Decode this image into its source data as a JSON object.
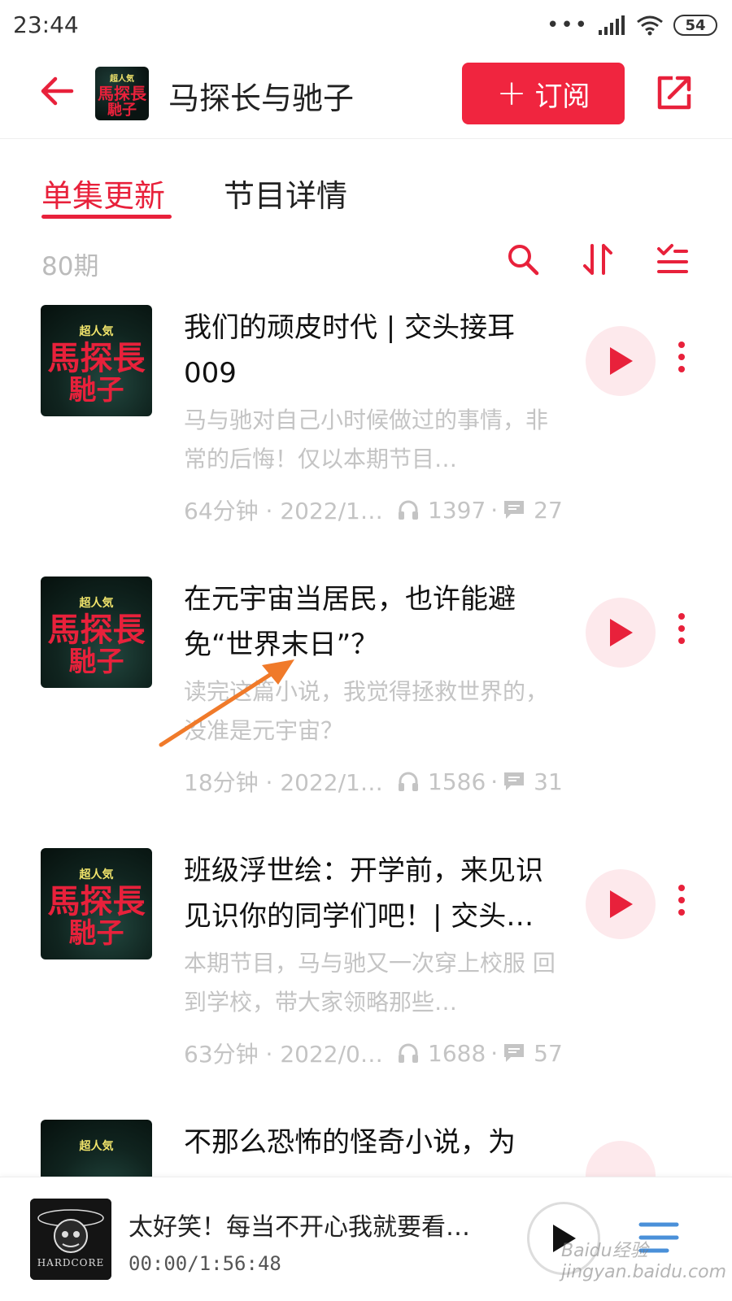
{
  "status_bar": {
    "time": "23:44",
    "battery": "54"
  },
  "header": {
    "title": "马探长与驰子",
    "subscribe_label": "订阅",
    "cover": {
      "top": "超人気",
      "main": "馬探長",
      "amp": "&",
      "sub": "馳子"
    }
  },
  "tabs": {
    "active": "单集更新",
    "other": "节目详情"
  },
  "list_info": {
    "count": "80期"
  },
  "episodes": [
    {
      "title": "我们的顽皮时代 | 交头接耳009",
      "desc": "马与驰对自己小时候做过的事情，非常的后悔！仅以本期节目…",
      "duration_date": "64分钟 · 2022/1…",
      "plays": "1397",
      "comments": "27"
    },
    {
      "title": "在元宇宙当居民，也许能避免“世界末日”？",
      "desc": "读完这篇小说，我觉得拯救世界的，没准是元宇宙？",
      "duration_date": "18分钟 · 2022/1…",
      "plays": "1586",
      "comments": "31"
    },
    {
      "title": "班级浮世绘：开学前，来见识见识你的同学们吧！| 交头…",
      "desc": "本期节目，马与驰又一次穿上校服 回到学校，带大家领略那些…",
      "duration_date": "63分钟 · 2022/0…",
      "plays": "1688",
      "comments": "57"
    },
    {
      "title": "不那么恐怖的怪奇小说，为"
    }
  ],
  "player": {
    "title": "太好笑！每当不开心我就要看…",
    "time": "00:00/1:56:48",
    "cover_label": "HARDCORE"
  },
  "watermark": "Baidu经验 jingyan.baidu.com",
  "colors": {
    "accent": "#e8213b",
    "muted": "#c4c4c4"
  }
}
